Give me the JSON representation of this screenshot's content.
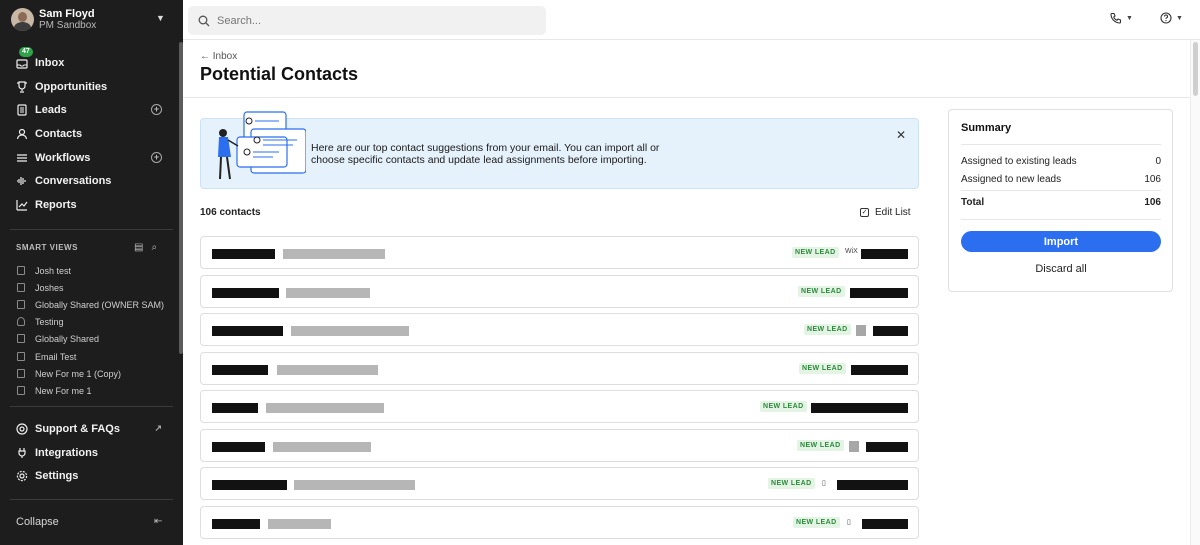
{
  "user": {
    "name": "Sam Floyd",
    "org": "PM Sandbox"
  },
  "nav": {
    "inbox_badge": "47",
    "items": [
      {
        "label": "Inbox"
      },
      {
        "label": "Opportunities"
      },
      {
        "label": "Leads"
      },
      {
        "label": "Contacts"
      },
      {
        "label": "Workflows"
      },
      {
        "label": "Conversations"
      },
      {
        "label": "Reports"
      }
    ]
  },
  "smart_views": {
    "title": "SMART VIEWS",
    "items": [
      {
        "label": "Josh test",
        "icon": "list-icon"
      },
      {
        "label": "Joshes",
        "icon": "list-icon"
      },
      {
        "label": "Globally Shared (OWNER SAM)",
        "icon": "list-icon"
      },
      {
        "label": "Testing",
        "icon": "person-icon"
      },
      {
        "label": "Globally Shared",
        "icon": "list-icon"
      },
      {
        "label": "Email Test",
        "icon": "list-icon"
      },
      {
        "label": "New For me 1 (Copy)",
        "icon": "list-icon"
      },
      {
        "label": "New For me 1",
        "icon": "list-icon"
      }
    ]
  },
  "bottom_nav": [
    {
      "label": "Support & FAQs"
    },
    {
      "label": "Integrations"
    },
    {
      "label": "Settings"
    }
  ],
  "collapse_label": "Collapse",
  "search": {
    "placeholder": "Search..."
  },
  "header": {
    "back_label": "Inbox",
    "title": "Potential Contacts"
  },
  "banner": {
    "text": "Here are our top contact suggestions from your email. You can import all or choose specific contacts and update lead assignments before importing."
  },
  "list": {
    "count_label": "106 contacts",
    "edit_label": "Edit List",
    "badge_label": "NEW LEAD",
    "rows": [
      {
        "badge": "NEW LEAD",
        "extra_icon": "wix-logo-icon"
      },
      {
        "badge": "NEW LEAD",
        "extra_icon": "none"
      },
      {
        "badge": "NEW LEAD",
        "extra_icon": "grey-logo-icon"
      },
      {
        "badge": "NEW LEAD",
        "extra_icon": "none"
      },
      {
        "badge": "NEW LEAD",
        "extra_icon": "none"
      },
      {
        "badge": "NEW LEAD",
        "extra_icon": "grey-logo-icon"
      },
      {
        "badge": "NEW LEAD",
        "extra_icon": "building-icon"
      },
      {
        "badge": "NEW LEAD",
        "extra_icon": "building-icon"
      }
    ]
  },
  "summary": {
    "title": "Summary",
    "existing_label": "Assigned to existing leads",
    "existing_value": "0",
    "new_label": "Assigned to new leads",
    "new_value": "106",
    "total_label": "Total",
    "total_value": "106",
    "import_label": "Import",
    "discard_label": "Discard all"
  },
  "colors": {
    "accent": "#2b6ff0",
    "sidebar": "#1d1d1d",
    "banner": "#e5f1fb",
    "badge_green": "#2d8a3b"
  }
}
